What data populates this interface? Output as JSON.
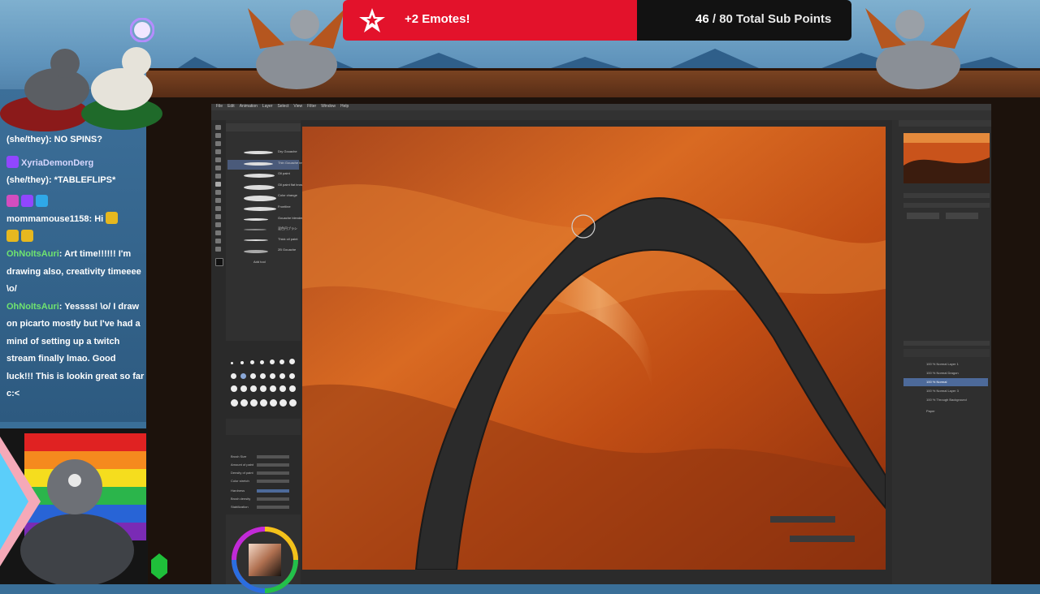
{
  "alert": {
    "label": "+2 Emotes!",
    "current": "46",
    "separator": " / ",
    "goal_text": "80 Total Sub Points"
  },
  "chat": {
    "messages": [
      {
        "user": "",
        "text": "(she/they): NO SPINS?"
      },
      {
        "user": "XyriaDemonDerg",
        "text": ""
      },
      {
        "user": "",
        "text": "(she/they): *TABLEFLIPS*"
      },
      {
        "user": "mommamouse1158",
        "text": "Hi"
      },
      {
        "user": "OhNoItsAuri",
        "text": "Art time!!!!!! I'm drawing also, creativity timeeee \\o/"
      },
      {
        "user": "OhNoItsAuri",
        "text": "Yessss! \\o/ I draw on picarto mostly but I've had a mind of setting up a twitch stream finally lmao. Good luck!!! This is lookin great so far c:<"
      }
    ]
  },
  "app": {
    "menu": [
      "File",
      "Edit",
      "Animation",
      "Layer",
      "Select",
      "View",
      "Filter",
      "Window",
      "Help"
    ],
    "brushes": [
      "Dry Gouache",
      "Thin Gouache brush",
      "Oil paint",
      "Oil paint flat brush",
      "Color change",
      "Frontline",
      "Gouache blender",
      "混色円ブラシ",
      "Thick oil paint",
      "2B Gouache"
    ],
    "add_tool": "Add tool",
    "brush_props": [
      "Brush Size",
      "Amount of paint",
      "Density of paint",
      "Color stretch",
      "Hardness",
      "Brush density",
      "Stabilization"
    ],
    "layers": [
      "100 % Normal Layer 1",
      "100 % Normal Dragon",
      "100 % Normal",
      "100 % Normal Layer 3",
      "100 % Through Background",
      "Paper"
    ],
    "colors": {
      "accent": "#e3122b",
      "chat_user": "#6fe36f",
      "sketch_stroke": "#2b2b2b",
      "canvas_orange": "#c8531a"
    }
  }
}
